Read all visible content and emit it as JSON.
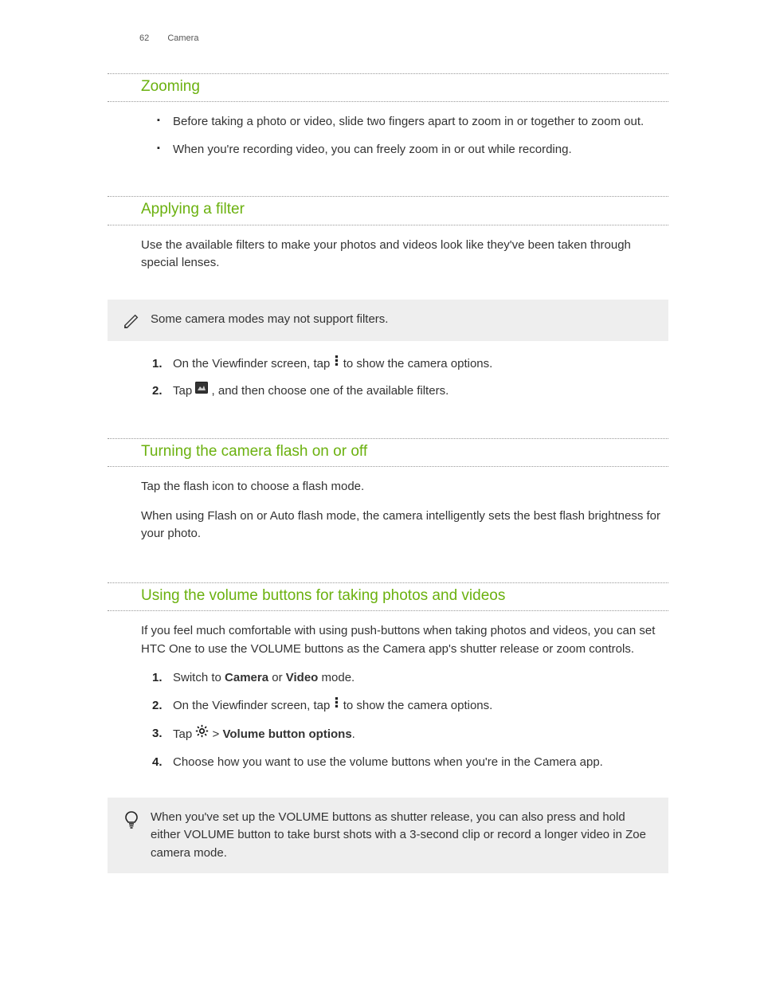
{
  "header": {
    "page_num": "62",
    "chapter": "Camera"
  },
  "sec_zoom": {
    "title": "Zooming",
    "b1": "Before taking a photo or video, slide two fingers apart to zoom in or together to zoom out.",
    "b2": "When you're recording video, you can freely zoom in or out while recording."
  },
  "sec_filter": {
    "title": "Applying a filter",
    "intro": "Use the available filters to make your photos and videos look like they've been taken through special lenses.",
    "note": "Some camera modes may not support filters.",
    "s1a": "On the Viewfinder screen, tap ",
    "s1b": " to show the camera options.",
    "s2a": "Tap ",
    "s2b": " , and then choose one of the available filters."
  },
  "sec_flash": {
    "title": "Turning the camera flash on or off",
    "p1": "Tap the flash icon to choose a flash mode.",
    "p2": "When using Flash on or Auto flash mode, the camera intelligently sets the best flash brightness for your photo."
  },
  "sec_vol": {
    "title": "Using the volume buttons for taking photos and videos",
    "intro": "If you feel much comfortable with using push-buttons when taking photos and videos, you can set HTC One to use the VOLUME buttons as the Camera app's shutter release or zoom controls.",
    "s1a": "Switch to ",
    "s1b": "Camera",
    "s1c": " or ",
    "s1d": "Video",
    "s1e": " mode.",
    "s2a": "On the Viewfinder screen, tap ",
    "s2b": " to show the camera options.",
    "s3a": "Tap ",
    "s3b": "  > ",
    "s3c": "Volume button options",
    "s3d": ".",
    "s4": "Choose how you want to use the volume buttons when you're in the Camera app.",
    "tip": "When you've set up the VOLUME buttons as shutter release, you can also press and hold either VOLUME button to take burst shots with a 3-second clip or record a longer video in Zoe camera mode."
  }
}
